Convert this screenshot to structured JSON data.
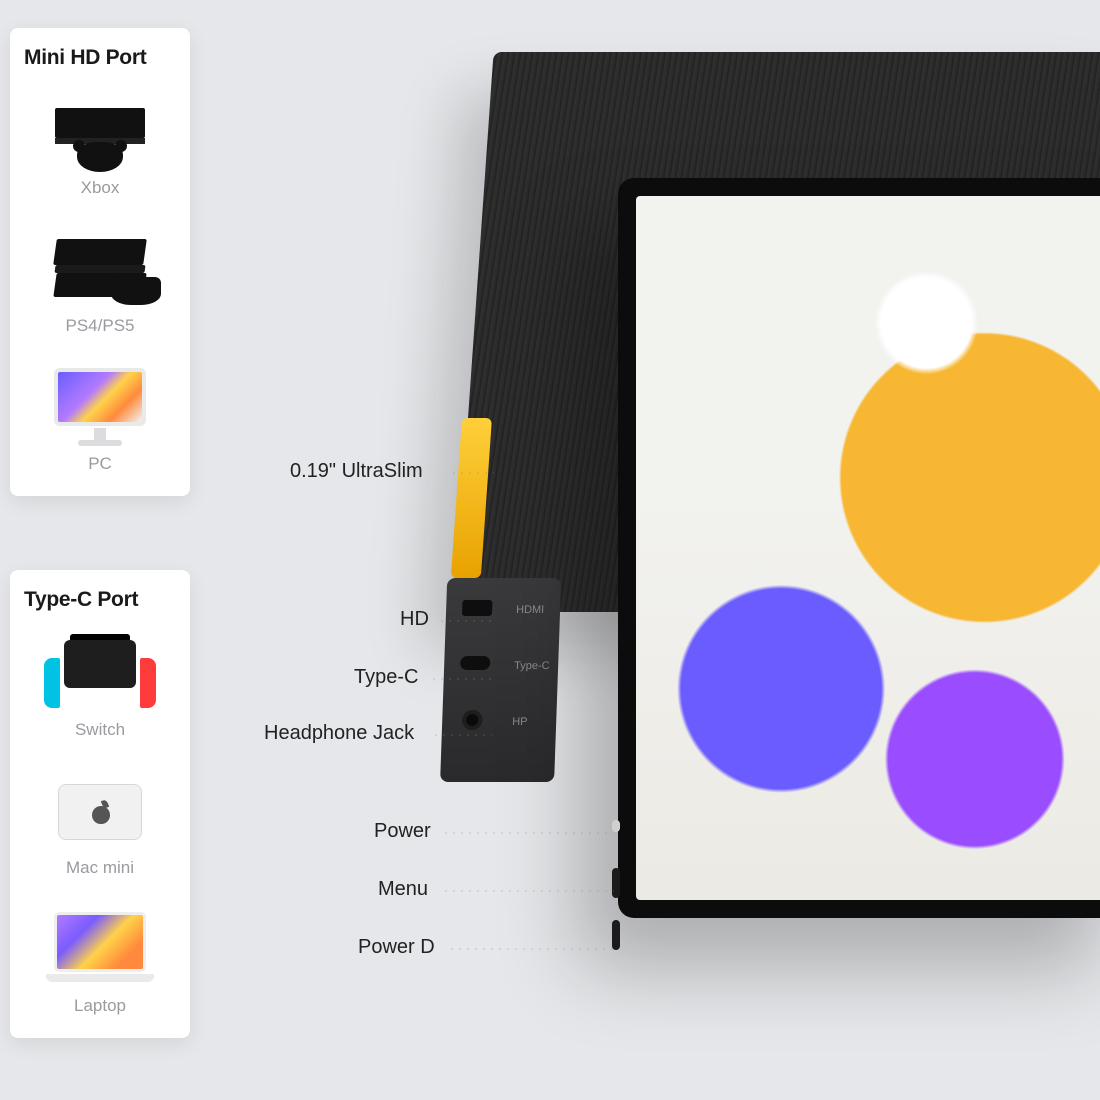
{
  "sidebar": {
    "hd": {
      "title": "Mini HD Port",
      "items": [
        {
          "label": "Xbox",
          "icon": "xbox-icon"
        },
        {
          "label": "PS4/PS5",
          "icon": "playstation-icon"
        },
        {
          "label": "PC",
          "icon": "pc-icon"
        }
      ]
    },
    "tc": {
      "title": "Type-C Port",
      "items": [
        {
          "label": "Switch",
          "icon": "switch-icon"
        },
        {
          "label": "Mac mini",
          "icon": "mac-mini-icon"
        },
        {
          "label": "Laptop",
          "icon": "laptop-icon"
        }
      ]
    }
  },
  "callouts": {
    "ultra_slim": "0.19\" UltraSlim",
    "hd": "HD",
    "type_c": "Type-C",
    "hp_jack": "Headphone Jack",
    "power": "Power",
    "menu": "Menu",
    "power_d": "Power D"
  },
  "port_labels": {
    "hdmi": "HDMI",
    "type_c": "Type-C",
    "hp": "HP"
  }
}
